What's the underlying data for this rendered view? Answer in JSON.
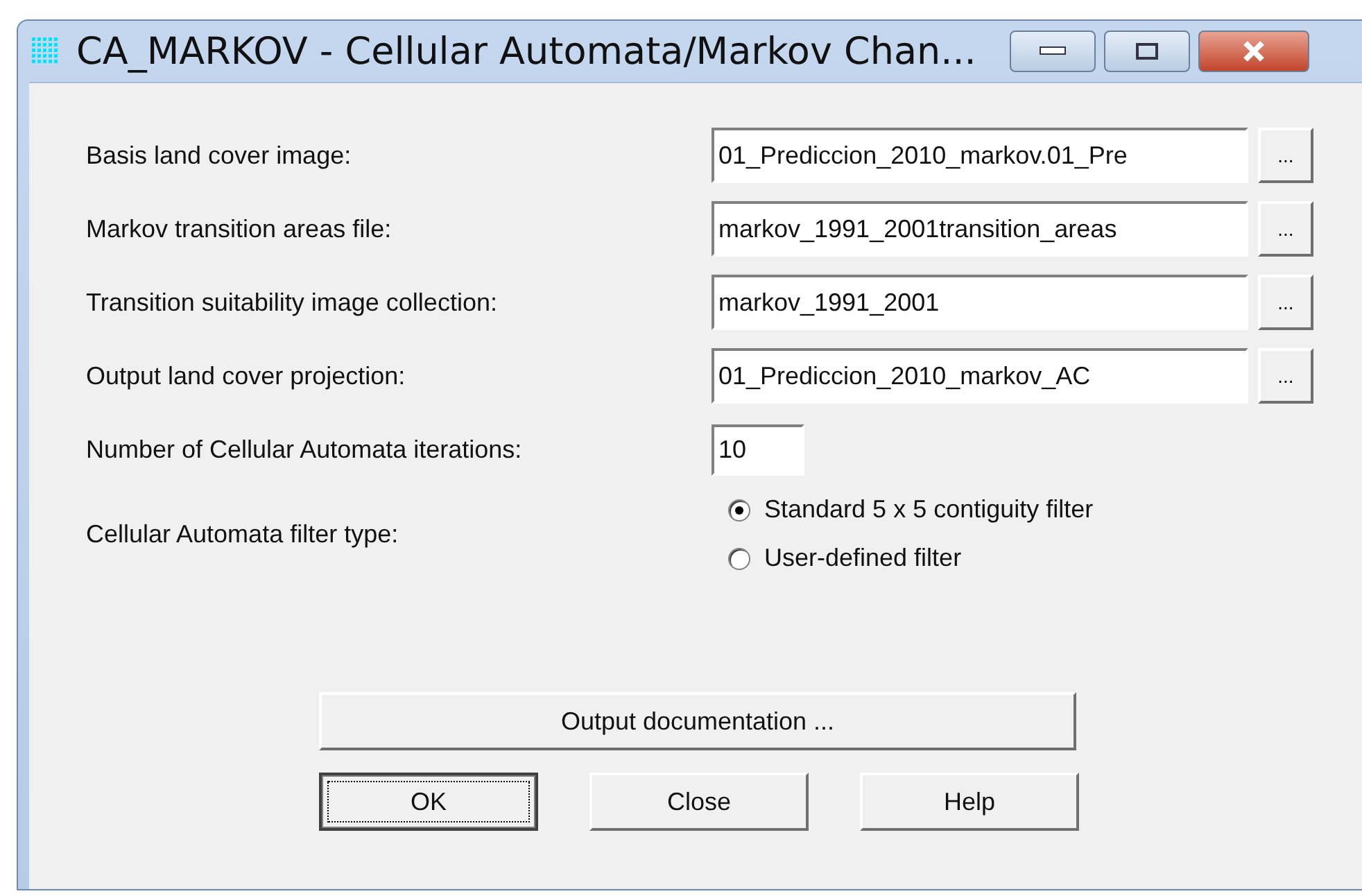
{
  "window": {
    "title": "CA_MARKOV - Cellular Automata/Markov Chan..."
  },
  "file_rows": [
    {
      "label": "Basis land cover image:",
      "value": "01_Prediccion_2010_markov.01_Pre",
      "browse": "..."
    },
    {
      "label": "Markov transition areas file:",
      "value": "markov_1991_2001transition_areas",
      "browse": "..."
    },
    {
      "label": "Transition suitability image collection:",
      "value": "markov_1991_2001",
      "browse": "..."
    },
    {
      "label": "Output land cover projection:",
      "value": "01_Prediccion_2010_markov_AC",
      "browse": "..."
    }
  ],
  "iterations": {
    "label": "Number of Cellular Automata iterations:",
    "value": "10"
  },
  "filter": {
    "label": "Cellular Automata filter type:",
    "options": [
      {
        "label": "Standard 5 x 5 contiguity filter",
        "selected": true
      },
      {
        "label": "User-defined filter",
        "selected": false
      }
    ]
  },
  "doc_button": "Output documentation ...",
  "buttons": [
    {
      "label": "OK",
      "focused": true
    },
    {
      "label": "Close",
      "focused": false
    },
    {
      "label": "Help",
      "focused": false
    }
  ]
}
